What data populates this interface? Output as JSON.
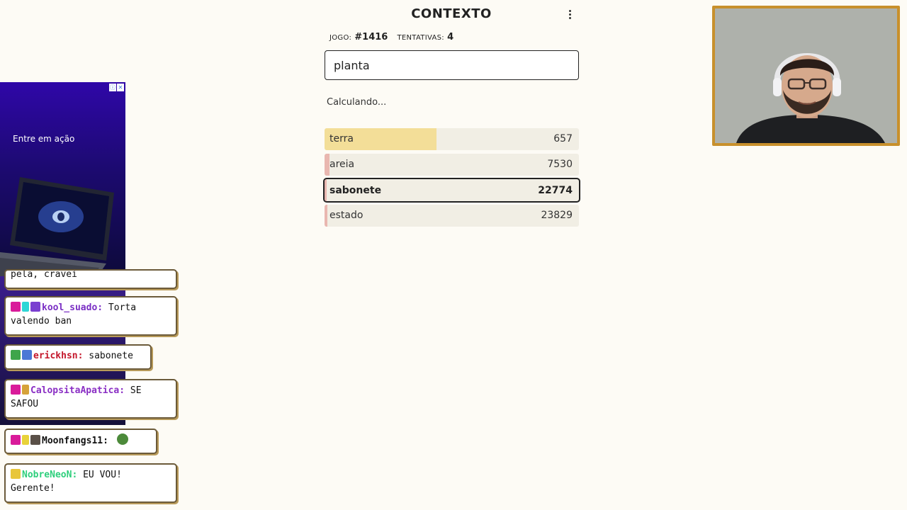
{
  "game": {
    "title": "CONTEXTO",
    "game_label": "JOGO:",
    "game_number": "#1416",
    "attempts_label": "TENTATIVAS:",
    "attempts": "4",
    "input_value": "planta",
    "status": "Calculando..."
  },
  "guesses": [
    {
      "word": "terra",
      "rank": "657",
      "fill_fraction": 0.44,
      "fill_color": "#f3de98"
    },
    {
      "word": "areia",
      "rank": "7530",
      "fill_fraction": 0.02,
      "fill_color": "#e9b7b0"
    },
    {
      "word": "sabonete",
      "rank": "22774",
      "fill_fraction": 0.0,
      "fill_color": "#e9b7b0",
      "current": true
    },
    {
      "word": "estado",
      "rank": "23829",
      "fill_fraction": 0.01,
      "fill_color": "#e9b7b0"
    }
  ],
  "ad": {
    "text": "Entre em ação"
  },
  "chat": {
    "messages": [
      {
        "user": "pela, cravei",
        "text": "",
        "color": "#111111"
      },
      {
        "user": "kool_suado:",
        "text": "Torta valendo ban",
        "color": "#7a2fc4"
      },
      {
        "user": "erickhsn:",
        "text": "sabonete",
        "color": "#c4162a"
      },
      {
        "user": "CalopsitaApatica:",
        "text": "SE SAFOU",
        "color": "#8a2fc4"
      },
      {
        "user": "Moonfangs11:",
        "text": "",
        "color": "#111111"
      },
      {
        "user": "NobreNeoN:",
        "text": "EU VOU! Gerente!",
        "color": "#2ecf7c"
      }
    ]
  }
}
